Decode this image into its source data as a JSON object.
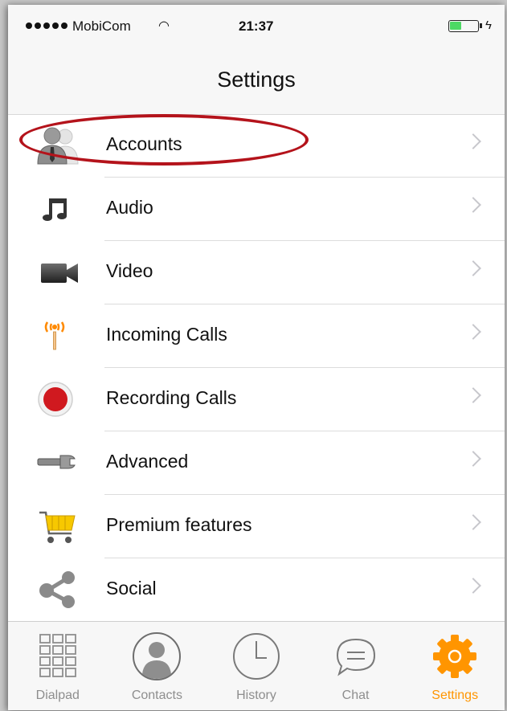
{
  "status_bar": {
    "carrier": "MobiCom",
    "time": "21:37"
  },
  "nav": {
    "title": "Settings"
  },
  "settings_items": [
    {
      "label": "Accounts",
      "icon": "accounts-icon"
    },
    {
      "label": "Audio",
      "icon": "music-note-icon"
    },
    {
      "label": "Video",
      "icon": "video-camera-icon"
    },
    {
      "label": "Incoming Calls",
      "icon": "antenna-icon"
    },
    {
      "label": "Recording Calls",
      "icon": "record-icon"
    },
    {
      "label": "Advanced",
      "icon": "wrench-icon"
    },
    {
      "label": "Premium features",
      "icon": "shopping-cart-icon"
    },
    {
      "label": "Social",
      "icon": "share-icon"
    }
  ],
  "tabs": [
    {
      "label": "Dialpad",
      "icon": "dialpad-icon"
    },
    {
      "label": "Contacts",
      "icon": "contacts-icon"
    },
    {
      "label": "History",
      "icon": "clock-icon"
    },
    {
      "label": "Chat",
      "icon": "chat-bubble-icon"
    },
    {
      "label": "Settings",
      "icon": "gear-icon",
      "active": true
    }
  ],
  "colors": {
    "accent": "#ff9500",
    "highlight_ring": "#b4131b",
    "record": "#d0191f"
  }
}
